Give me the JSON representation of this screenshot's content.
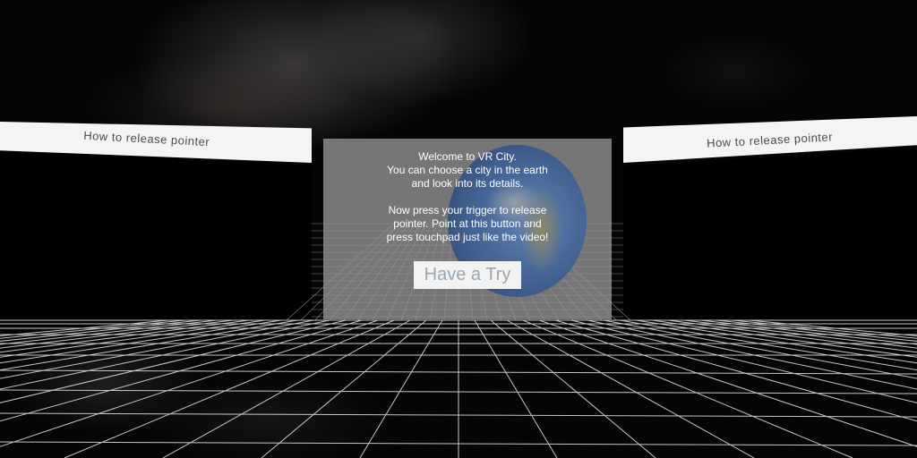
{
  "left_banner": {
    "label": "How to release pointer"
  },
  "right_banner": {
    "label": "How to release pointer"
  },
  "welcome_panel": {
    "lines": [
      "Welcome to VR City.",
      "You can choose a city in the earth",
      "and look into its details."
    ],
    "instruction_lines": [
      "Now press your trigger to release",
      "pointer. Point at this button and",
      "press touchpad just like the video!"
    ],
    "button_label": "Have a Try"
  },
  "colors": {
    "panel_bg": "#969696",
    "banner_bg": "#f4f4f4",
    "grid_line": "#e8e8e8",
    "button_text": "#9aa7b0"
  },
  "icons": {
    "globe": "earth-globe-icon"
  }
}
